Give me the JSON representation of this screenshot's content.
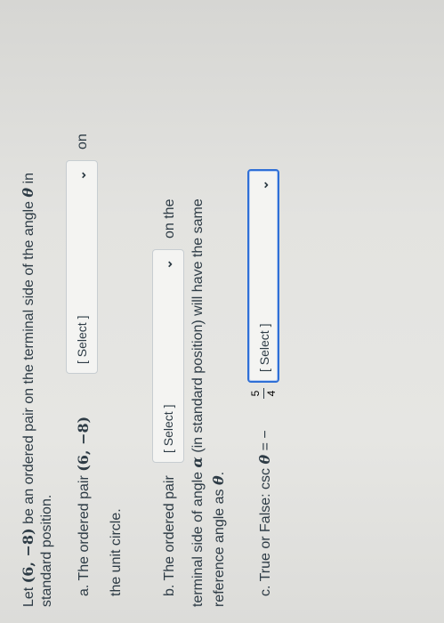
{
  "intro": {
    "line1_prefix": "Let ",
    "pair": "(6, −8)",
    "line1_mid": " be an ordered pair on the terminal side of the angle ",
    "theta": "θ",
    "line1_suffix": " in",
    "line2": "standard position."
  },
  "part_a": {
    "prefix": "a. The ordered pair ",
    "pair": "(6, −8)",
    "select_label": "[ Select ]",
    "suffix": "on",
    "line2": "the unit circle."
  },
  "part_b": {
    "prefix": "b. The ordered pair",
    "select_label": "[ Select ]",
    "suffix": "on the",
    "line2_prefix": "terminal side of angle ",
    "alpha": "α",
    "line2_suffix": " (in standard position) will have the same",
    "line3_prefix": "reference angle as ",
    "line3_theta": "θ",
    "line3_suffix": "."
  },
  "part_c": {
    "prefix": "c. True or False: csc ",
    "theta": "θ",
    "equals": " = −",
    "numerator": "5",
    "denominator": "4",
    "select_label": "[ Select ]"
  },
  "icons": {
    "dropdown": "chevron-down-icon"
  },
  "colors": {
    "text": "#2d3b45",
    "focus": "#2f6fd6"
  }
}
